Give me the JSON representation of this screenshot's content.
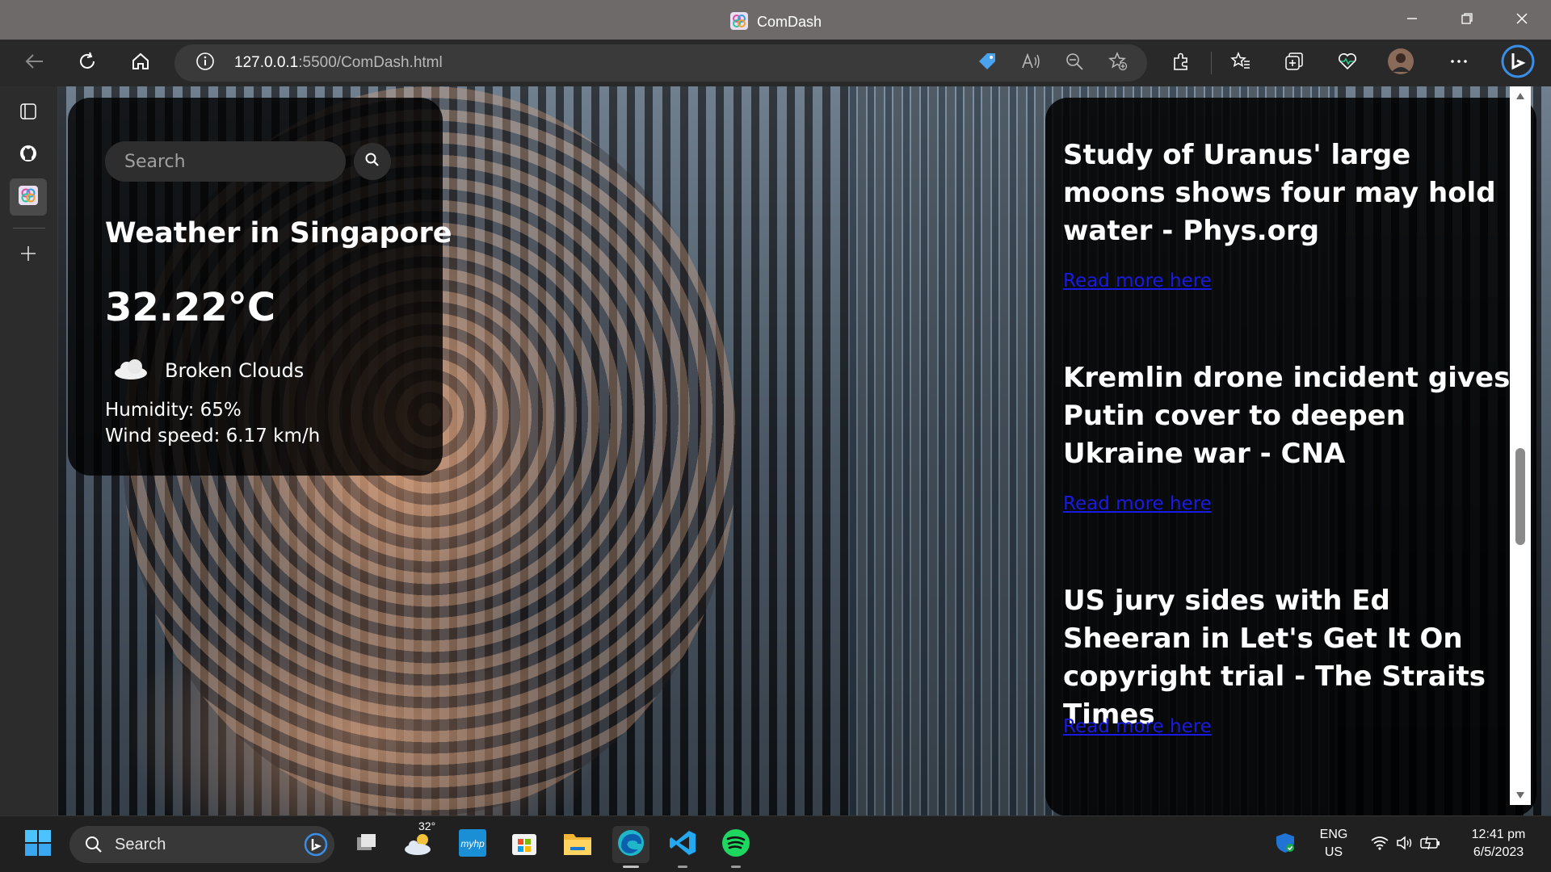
{
  "window": {
    "title": "ComDash"
  },
  "toolbar": {
    "url_host": "127.0.0.1",
    "url_rest": ":5500/ComDash.html"
  },
  "weather": {
    "search_placeholder": "Search",
    "title": "Weather in Singapore",
    "temperature": "32.22°C",
    "description": "Broken Clouds",
    "humidity": "Humidity: 65%",
    "wind": "Wind speed: 6.17 km/h"
  },
  "news": {
    "items": [
      {
        "title": "Study of Uranus' large moons shows four may hold water - Phys.org",
        "link_text": "Read more here"
      },
      {
        "title": "Kremlin drone incident gives Putin cover to deepen Ukraine war - CNA",
        "link_text": "Read more here"
      },
      {
        "title": "US jury sides with Ed Sheeran in Let's Get It On copyright trial - The Straits Times",
        "link_text": "Read more here"
      }
    ]
  },
  "taskbar": {
    "search_label": "Search",
    "weather_temp": "32°",
    "lang_line1": "ENG",
    "lang_line2": "US",
    "time": "12:41 pm",
    "date": "6/5/2023"
  },
  "icons": {
    "window_controls": [
      "minimize-icon",
      "maximize-icon",
      "close-icon"
    ],
    "nav": [
      "back-icon",
      "refresh-icon",
      "home-icon"
    ],
    "address": [
      "info-icon",
      "coupon-icon",
      "read-aloud-icon",
      "zoom-out-icon",
      "add-favorite-icon"
    ],
    "toolbar_right": [
      "extensions-icon",
      "favorites-icon",
      "collections-icon",
      "browser-essentials-icon",
      "profile-avatar",
      "more-icon",
      "bing-copilot-icon"
    ],
    "sidebar": [
      "tab-actions-icon",
      "github-icon",
      "comdash-app-icon",
      "add-icon"
    ],
    "taskbar": [
      "windows-start-icon",
      "search-icon",
      "bing-icon",
      "task-view-icon",
      "weather-widget-icon",
      "myhp-icon",
      "microsoft-store-icon",
      "file-explorer-icon",
      "edge-icon",
      "vscode-icon",
      "spotify-icon",
      "security-shield-icon",
      "wifi-icon",
      "volume-icon",
      "battery-icon"
    ]
  },
  "colors": {
    "titlebar": "#6e6a6a",
    "toolbar": "#292929",
    "card": "#000000",
    "link": "#1a1ae0",
    "spotify": "#1ed760",
    "vscode": "#23a9f2",
    "edge": "#1fb6c9"
  }
}
